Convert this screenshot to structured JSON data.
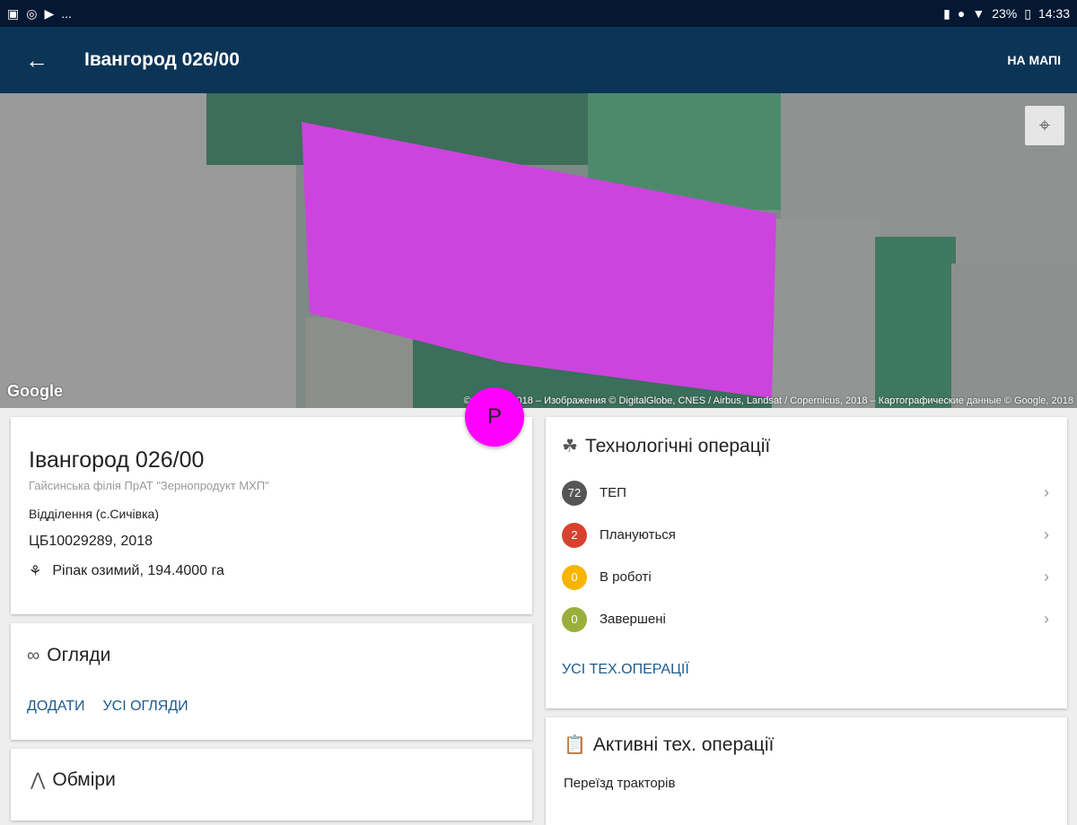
{
  "status": {
    "left_icons": [
      "image-icon",
      "vpn-icon",
      "play-icon"
    ],
    "more": "...",
    "battery": "23%",
    "time": "14:33"
  },
  "appbar": {
    "title": "Івангород 026/00",
    "action": "НА МАПІ"
  },
  "map": {
    "logo": "Google",
    "attribution": "© Google, 2018 – Изображения © DigitalGlobe, CNES / Airbus, Landsat / Copernicus, 2018 – Картографические данные © Google, 2018",
    "field_color": "#cc44dd"
  },
  "fab": {
    "label": "P",
    "color": "#ff00ff"
  },
  "field": {
    "name": "Івангород 026/00",
    "company": "Гайсинська філія ПрАТ \"Зернопродукт МХП\"",
    "division": "Відділення (с.Сичівка)",
    "code": "ЦБ10029289, 2018",
    "crop": "Ріпак озимий, 194.4000 га"
  },
  "inspections": {
    "title": "Огляди",
    "add": "ДОДАТИ",
    "all": "УСІ ОГЛЯДИ"
  },
  "measurements": {
    "title": "Обміри"
  },
  "operations": {
    "title": "Технологічні операції",
    "items": [
      {
        "count": "72",
        "label": "ТЕП",
        "color": "#555555"
      },
      {
        "count": "2",
        "label": "Плануються",
        "color": "#d9412f"
      },
      {
        "count": "0",
        "label": "В роботі",
        "color": "#f7b500"
      },
      {
        "count": "0",
        "label": "Завершені",
        "color": "#9aae3c"
      }
    ],
    "all": "УСІ ТЕХ.ОПЕРАЦІЇ"
  },
  "active": {
    "title": "Активні тех. операції",
    "item": "Переїзд тракторів"
  }
}
